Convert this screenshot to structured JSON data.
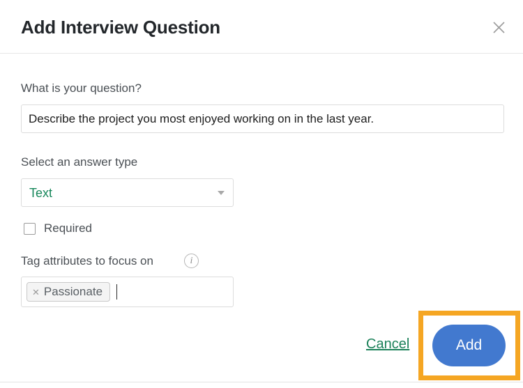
{
  "modal": {
    "title": "Add Interview Question",
    "close_icon": "close-icon"
  },
  "form": {
    "question": {
      "label": "What is your question?",
      "value": "Describe the project you most enjoyed working on in the last year.",
      "placeholder": "What is your question?"
    },
    "answer_type": {
      "label": "Select an answer type",
      "selected": "Text",
      "options": [
        "Text"
      ],
      "caret_icon": "chevron-down-icon",
      "accent_color": "#17875b"
    },
    "required": {
      "label": "Required",
      "checked": false
    },
    "tag_attributes": {
      "label": "Tag attributes to focus on",
      "info_icon": "info-icon",
      "info_glyph": "i",
      "tags": [
        {
          "label": "Passionate",
          "remove_glyph": "✕"
        }
      ],
      "placeholder": ""
    }
  },
  "footer": {
    "cancel_label": "Cancel",
    "cancel_color": "#1b8159",
    "add_label": "Add",
    "add_color": "#4279cf",
    "highlight_color": "#f5a623"
  }
}
